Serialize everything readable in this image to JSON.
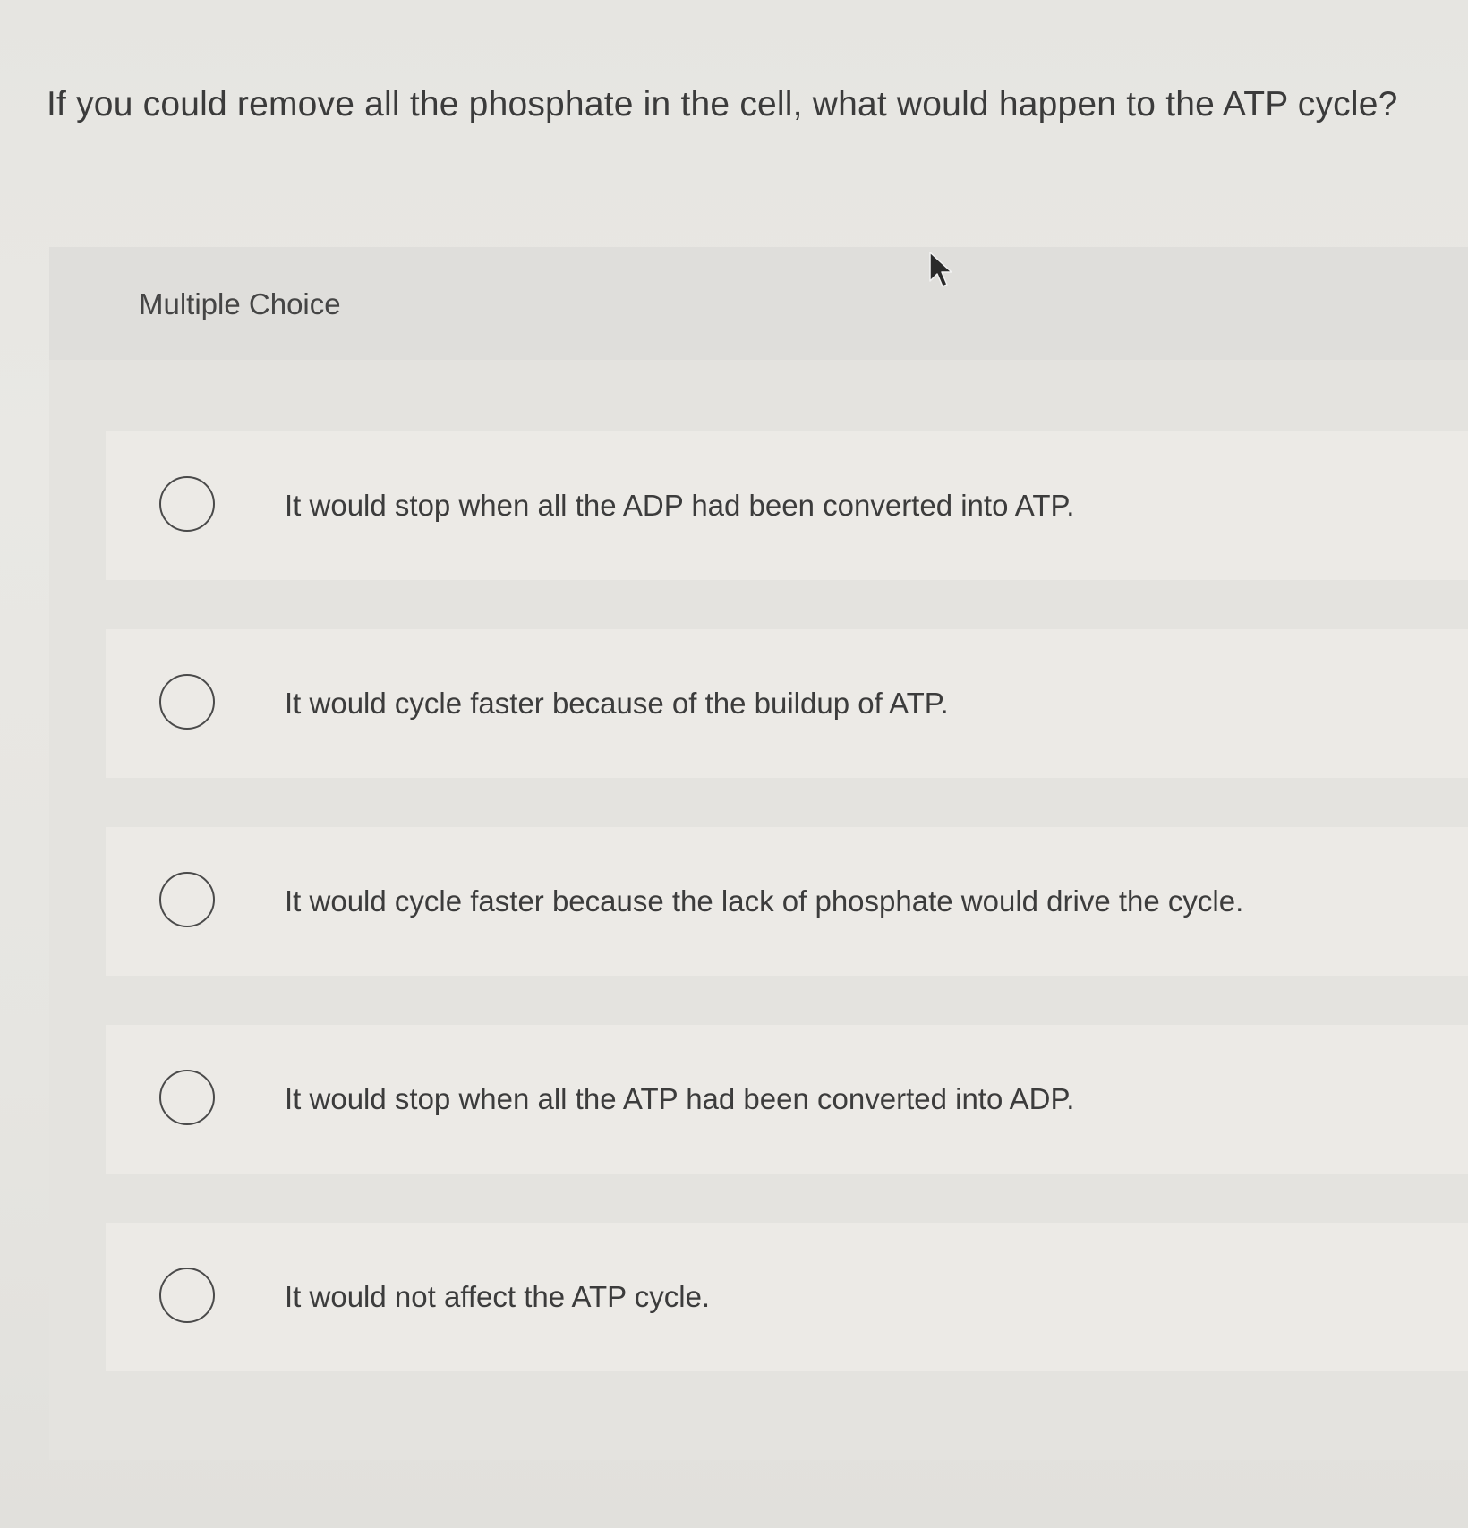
{
  "question": {
    "text": "If you could remove all the phosphate in the cell, what would happen to the ATP cycle?"
  },
  "multiple_choice": {
    "label": "Multiple Choice",
    "options": [
      {
        "text": "It would stop when all the ADP had been converted into ATP.",
        "selected": false
      },
      {
        "text": "It would cycle faster because of the buildup of ATP.",
        "selected": false
      },
      {
        "text": "It would cycle faster because the lack of phosphate would drive the cycle.",
        "selected": false
      },
      {
        "text": "It would stop when all the ATP had been converted into ADP.",
        "selected": false
      },
      {
        "text": "It would not affect the ATP cycle.",
        "selected": false
      }
    ]
  },
  "icons": {
    "cursor": "mouse-pointer-icon",
    "radio": "radio-button-unselected"
  },
  "colors": {
    "text": "#3a3a3a",
    "radio_border": "#4a4a4a"
  }
}
